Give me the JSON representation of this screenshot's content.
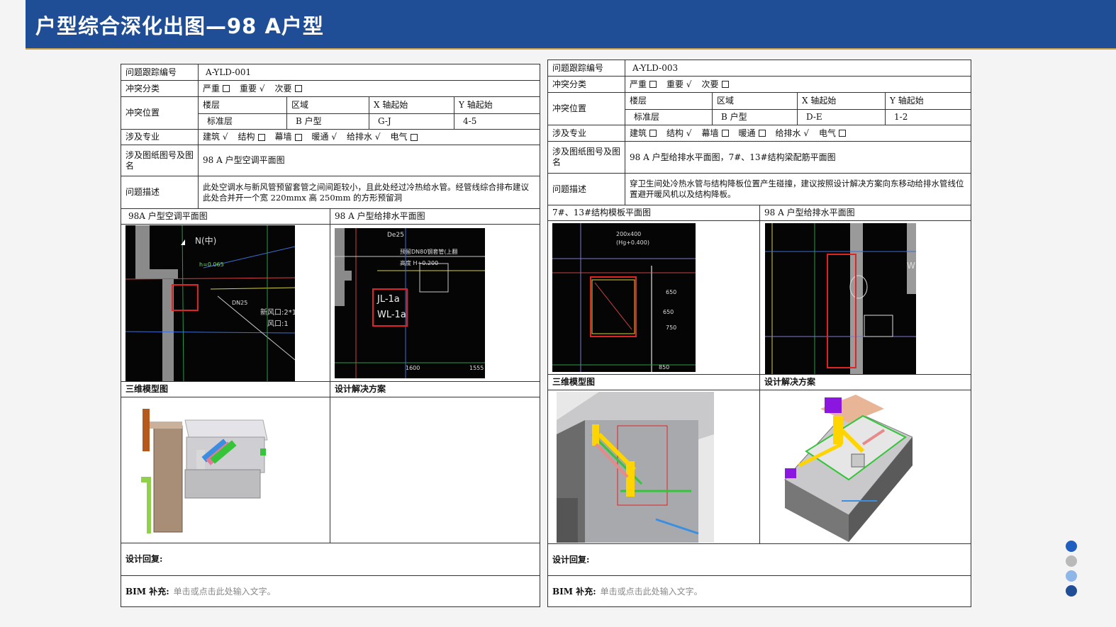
{
  "header": {
    "title": "户型综合深化出图—98 A户型"
  },
  "labels": {
    "issue_no": "问题跟踪编号",
    "category": "冲突分类",
    "position": "冲突位置",
    "discipline": "涉及专业",
    "drawing": "涉及图纸图号及图名",
    "description": "问题描述",
    "model_3d": "三维模型图",
    "solution": "设计解决方案",
    "reply": "设计回复:",
    "bim_label": "BIM 补充:",
    "bim_placeholder": "单击或点击此处输入文字。",
    "floor": "楼层",
    "zone": "区域",
    "x_axis": "X 轴起始",
    "y_axis": "Y 轴起始"
  },
  "severity": {
    "serious": "严重",
    "important": "重要",
    "minor": "次要"
  },
  "disciplines": {
    "arch": "建筑",
    "struct": "结构",
    "curtain": "幕墙",
    "hvac": "暖通",
    "plumbing": "给排水",
    "elec": "电气"
  },
  "sheets": [
    {
      "issue_no": "A-YLD-001",
      "severity_checked": "important",
      "floor": "标准层",
      "zone": "B 户型",
      "x": "G-J",
      "y": "4-5",
      "disciplines_checked": [
        "arch",
        "struct",
        "hvac",
        "plumbing"
      ],
      "drawing": "98 A 户型空调平面图",
      "description": "此处空调水与新风管预留套管之间间距较小，且此处经过冷热给水管。经管线综合排布建议此处合并开一个宽 220mmx 高 250mm 的方形预留洞",
      "img_left_caption": "98A 户型空调平面图",
      "img_right_caption": "98 A 户型给排水平面图",
      "cad_texts_left": [
        "N(中)",
        "h=0.065",
        "DN25",
        "新风口:2*1",
        "风口:1"
      ],
      "cad_texts_right": [
        "De25",
        "预留DN80钢套管(上翻",
        "高度 H+0.200",
        "JL-1a",
        "WL-1a",
        "1600",
        "1555"
      ]
    },
    {
      "issue_no": "A-YLD-003",
      "severity_checked": "important",
      "floor": "标准层",
      "zone": "B 户型",
      "x": "D-E",
      "y": "1-2",
      "disciplines_checked": [
        "struct",
        "plumbing"
      ],
      "drawing": "98 A 户型给排水平面图，7#、13#结构梁配筋平面图",
      "description": "穿卫生间处冷热水管与结构降板位置产生碰撞，建议按照设计解决方案向东移动给排水管线位置避开暖风机以及结构降板。",
      "img_left_caption": "7#、13#结构模板平面图",
      "img_right_caption": "98 A 户型给排水平面图",
      "cad_texts_left": [
        "200x400",
        "(Hg+0.400)",
        "650",
        "650",
        "750",
        "850"
      ],
      "cad_texts_right": [
        "W"
      ]
    }
  ],
  "colors": {
    "header_bg": "#1f4e96",
    "dot1": "#1f5fbf",
    "dot2": "#b9b9b9",
    "dot3": "#8fb6e8",
    "dot4": "#1f4e96"
  }
}
